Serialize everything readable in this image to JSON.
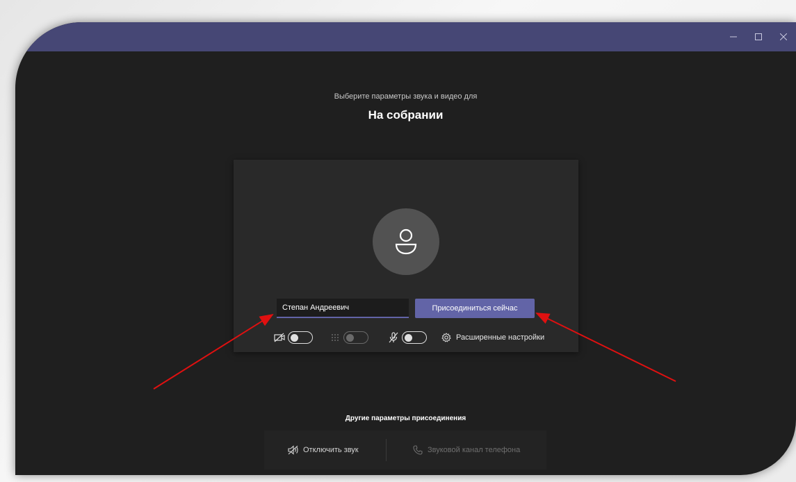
{
  "window": {
    "title_bar_color": "#464775",
    "controls": [
      {
        "name": "minimize",
        "icon": "minimize-icon"
      },
      {
        "name": "maximize",
        "icon": "maximize-icon"
      },
      {
        "name": "close",
        "icon": "close-icon"
      }
    ]
  },
  "prejoin": {
    "prompt": "Выберите параметры звука и видео для",
    "meeting_title": "На собрании",
    "name_value": "Степан Андреевич",
    "join_label": "Присоединиться сейчас",
    "controls": {
      "camera": {
        "icon": "camera-off-icon",
        "on": false
      },
      "background_blur": {
        "icon": "blur-icon",
        "on": false,
        "enabled": false
      },
      "microphone": {
        "icon": "mic-off-icon",
        "on": false
      }
    },
    "advanced_label": "Расширенные настройки"
  },
  "other_options": {
    "label": "Другие параметры присоединения",
    "mute_label": "Отключить звук",
    "phone_label": "Звуковой канал телефона"
  },
  "colors": {
    "accent": "#6264a7",
    "background": "#1f1f1f",
    "card": "#292929",
    "annotation_arrow": "#e01010"
  }
}
